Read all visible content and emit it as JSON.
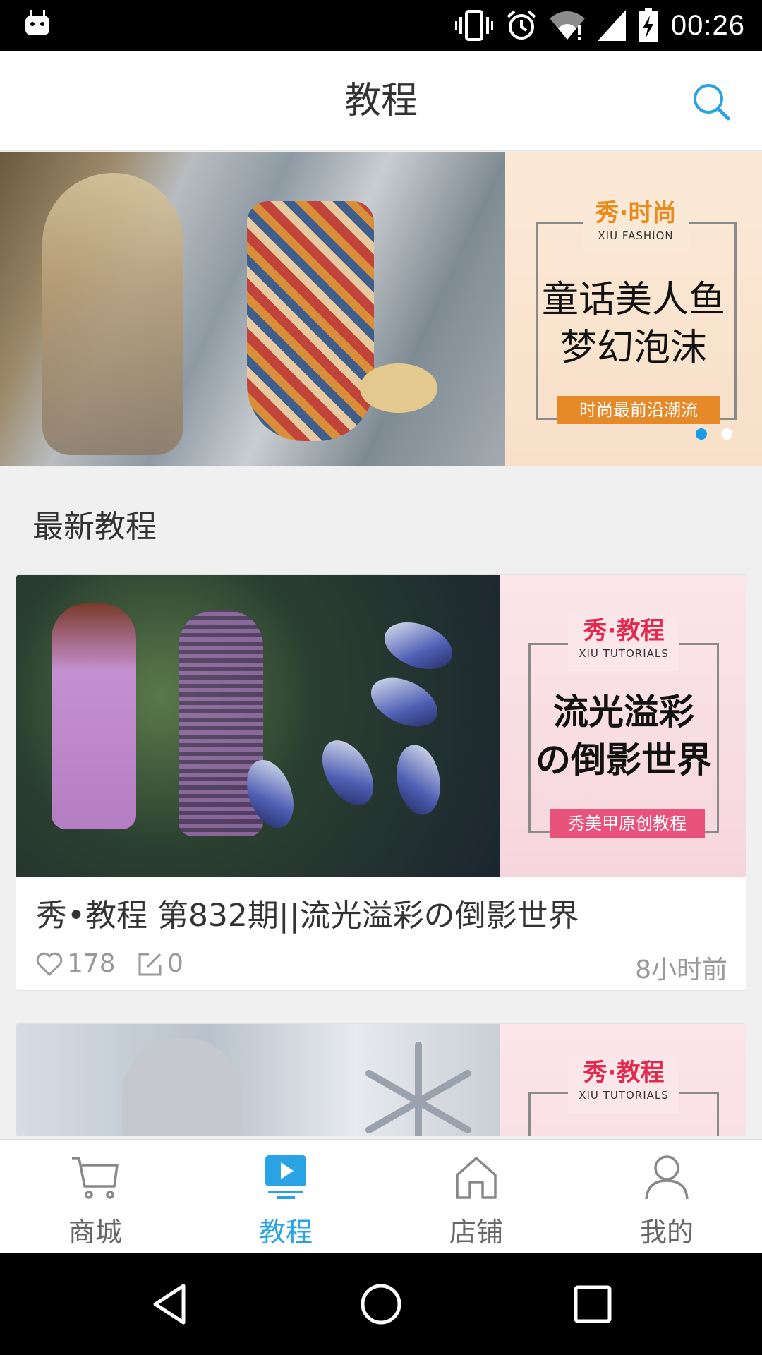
{
  "status_bar": {
    "time": "00:26",
    "icons": [
      "android-debug-icon",
      "vibrate-icon",
      "alarm-icon",
      "wifi-icon",
      "signal-icon",
      "battery-charging-icon"
    ]
  },
  "app_bar": {
    "title": "教程",
    "search_icon": "search-icon",
    "accent_color": "#29a3e4"
  },
  "banner": {
    "tag_cn": "秀·时尚",
    "tag_en": "XIU FASHION",
    "headline_line1": "童话美人鱼",
    "headline_line2": "梦幻泡沫",
    "ribbon": "时尚最前沿潮流",
    "active_page": 1,
    "page_count": 2
  },
  "section": {
    "title": "最新教程"
  },
  "cards": [
    {
      "tag_cn": "秀·教程",
      "tag_en": "XIU TUTORIALS",
      "headline_line1": "流光溢彩",
      "headline_line2": "の倒影世界",
      "ribbon": "秀美甲原创教程",
      "caption": "秀•教程 第832期||流光溢彩の倒影世界",
      "likes": "178",
      "comments": "0",
      "time": "8小时前"
    },
    {
      "tag_cn": "秀·教程",
      "tag_en": "XIU TUTORIALS"
    }
  ],
  "bottom_nav": {
    "items": [
      {
        "label": "商城",
        "icon": "cart-icon"
      },
      {
        "label": "教程",
        "icon": "play-screen-icon"
      },
      {
        "label": "店铺",
        "icon": "home-icon"
      },
      {
        "label": "我的",
        "icon": "user-icon"
      }
    ],
    "active_index": 1
  },
  "system_nav": {
    "icons": [
      "back-icon",
      "home-circle-icon",
      "recents-icon"
    ]
  }
}
